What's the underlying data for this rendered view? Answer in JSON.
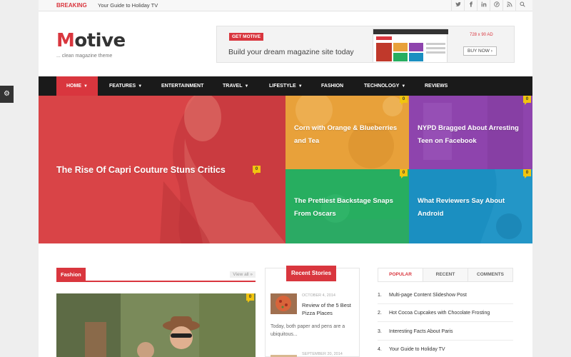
{
  "topbar": {
    "breaking_label": "BREAKING",
    "breaking_text": "Your Guide to Holiday TV",
    "social_icons": [
      "twitter-icon",
      "facebook-icon",
      "linkedin-icon",
      "pinterest-icon",
      "rss-icon",
      "search-icon"
    ]
  },
  "brand": {
    "logo_initial": "M",
    "logo_rest": "otive",
    "tagline": "... clean magazine theme"
  },
  "ad": {
    "tag": "GET MOTIVE",
    "headline": "Build your dream magazine site today",
    "size": "728 x 90 AD",
    "button": "BUY NOW ›"
  },
  "nav": {
    "items": [
      {
        "label": "HOME",
        "dropdown": true
      },
      {
        "label": "FEATURES",
        "dropdown": true
      },
      {
        "label": "ENTERTAINMENT",
        "dropdown": false
      },
      {
        "label": "TRAVEL",
        "dropdown": true
      },
      {
        "label": "LIFESTYLE",
        "dropdown": true
      },
      {
        "label": "FASHION",
        "dropdown": false
      },
      {
        "label": "TECHNOLOGY",
        "dropdown": true
      },
      {
        "label": "REVIEWS",
        "dropdown": false
      }
    ]
  },
  "hero": {
    "main": {
      "title": "The Rise Of Capri Couture Stuns Critics",
      "comments": "0"
    },
    "tiles": [
      {
        "title": "Corn with Orange & Blueberries and Tea",
        "comments": "0"
      },
      {
        "title": "NYPD Bragged About Arresting Teen on Facebook",
        "comments": "0"
      },
      {
        "title": "The Prettiest Backstage Snaps From Oscars",
        "comments": "0"
      },
      {
        "title": "What Reviewers Say About Android",
        "comments": "0"
      }
    ]
  },
  "fashion": {
    "label": "Fashion",
    "view_all": "View all »",
    "comments": "0"
  },
  "recent": {
    "label": "Recent Stories",
    "stories": [
      {
        "date": "OCTOBER 4, 2014",
        "title": "Review of the 5 Best Pizza Places",
        "excerpt": "Today, both paper and pens are a ubiquitous..."
      },
      {
        "date": "SEPTEMBER 20, 2014",
        "title": "",
        "excerpt": ""
      }
    ]
  },
  "sidebar_tabs": {
    "tabs": [
      "POPULAR",
      "RECENT",
      "COMMENTS"
    ],
    "popular": [
      {
        "num": "1.",
        "title": "Multi-page Content Slideshow Post"
      },
      {
        "num": "2.",
        "title": "Hot Cocoa Cupcakes with Chocolate Frosting"
      },
      {
        "num": "3.",
        "title": "Interesting Facts About Paris"
      },
      {
        "num": "4.",
        "title": "Your Guide to Holiday TV"
      }
    ]
  },
  "colors": {
    "accent": "#d9363e",
    "nav_bg": "#1a1a1a",
    "tile_orange": "#e8a13a",
    "tile_purple": "#8e44ad",
    "tile_green": "#27ae60",
    "tile_blue": "#1b8fc1",
    "badge": "#f1c40f"
  },
  "settings": {
    "icon": "gear-icon"
  }
}
